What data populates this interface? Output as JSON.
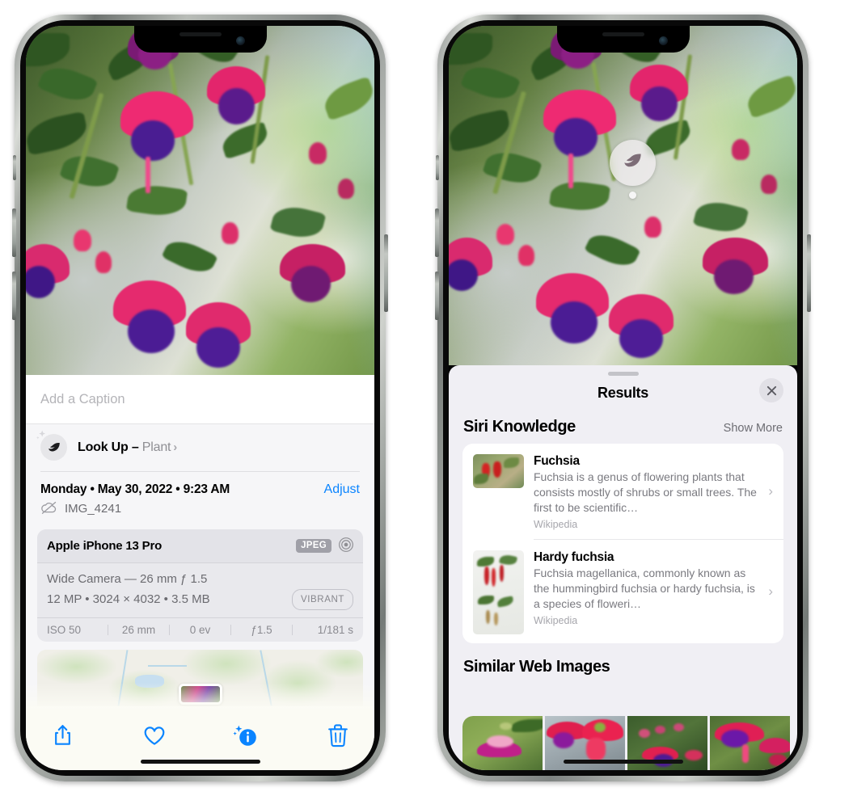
{
  "left_phone": {
    "name": "photos-detail-view",
    "photo": {
      "alt": "fuchsia-flowers-hanging-basket"
    },
    "caption_placeholder": "Add a Caption",
    "lookup": {
      "icon": "leaf-icon",
      "label": "Look Up",
      "separator": " – ",
      "subject": "Plant",
      "chevron": "›"
    },
    "date_line": "Monday • May 30, 2022 • 9:23 AM",
    "adjust_label": "Adjust",
    "filename": "IMG_4241",
    "cloud_icon": "icloud-slash-icon",
    "exif": {
      "device": "Apple iPhone 13 Pro",
      "format_badge": "JPEG",
      "lens_icon": "camera-lens-icon",
      "lens_line": "Wide Camera — 26 mm ƒ 1.5",
      "specs_line": "12 MP • 3024 × 4032 • 3.5 MB",
      "style_badge": "VIBRANT",
      "stats": [
        "ISO 50",
        "26 mm",
        "0 ev",
        "ƒ1.5",
        "1/181 s"
      ]
    },
    "toolbar": [
      {
        "name": "share-button",
        "icon": "share-icon"
      },
      {
        "name": "favorite-button",
        "icon": "heart-icon"
      },
      {
        "name": "info-button",
        "icon": "info-sparkle-icon"
      },
      {
        "name": "delete-button",
        "icon": "trash-icon"
      }
    ],
    "accent_color": "#0a84ff"
  },
  "right_phone": {
    "name": "visual-look-up-results",
    "badge": {
      "icon": "leaf-icon",
      "name": "visual-look-up-badge"
    },
    "sheet": {
      "title": "Results",
      "close_icon": "close-icon",
      "sections": [
        {
          "title": "Siri Knowledge",
          "action": "Show More",
          "cards": [
            {
              "title": "Fuchsia",
              "description": "Fuchsia is a genus of flowering plants that consists mostly of shrubs or small trees. The first to be scientific…",
              "source": "Wikipedia",
              "chevron": "›"
            },
            {
              "title": "Hardy fuchsia",
              "description": "Fuchsia magellanica, commonly known as the hummingbird fuchsia or hardy fuchsia, is a species of floweri…",
              "source": "Wikipedia",
              "chevron": "›"
            }
          ]
        },
        {
          "title": "Similar Web Images",
          "images": [
            {
              "alt": "fuchsia-web-image-1"
            },
            {
              "alt": "fuchsia-web-image-2"
            },
            {
              "alt": "fuchsia-web-image-3"
            },
            {
              "alt": "fuchsia-web-image-4"
            }
          ]
        }
      ]
    }
  }
}
